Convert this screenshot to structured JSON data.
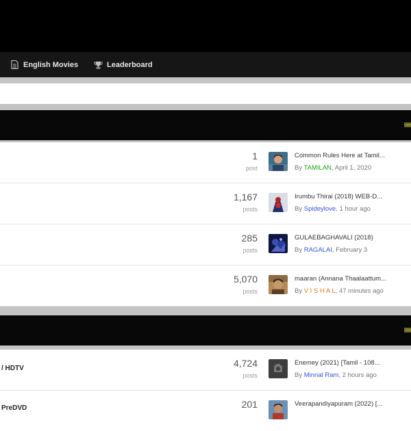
{
  "nav": {
    "items": [
      {
        "label": "English Movies",
        "icon": "document-icon"
      },
      {
        "label": "Leaderboard",
        "icon": "trophy-icon"
      }
    ]
  },
  "sections": [
    {
      "rows": [
        {
          "title": "",
          "count": "1",
          "unit": "post",
          "last_title": "Common Rules Here at Tamil...",
          "by": "By",
          "author": "TAMILAN",
          "author_color": "#1aa51a",
          "time": ", April 1, 2020"
        },
        {
          "title": "",
          "count": "1,167",
          "unit": "posts",
          "last_title": "Irumbu Thirai (2018) WEB-D...",
          "by": "By",
          "author": "Spideylove",
          "author_color": "#3a55d8",
          "time": ", 1 hour ago"
        },
        {
          "title": "",
          "count": "285",
          "unit": "posts",
          "last_title": "GULAEBAGHAVALI (2018)",
          "by": "By",
          "author": "RAGALAI",
          "author_color": "#3a55d8",
          "time": ", February 3"
        },
        {
          "title": "",
          "count": "5,070",
          "unit": "posts",
          "last_title": "maaran (Annana Thaalaattum...",
          "by": "By",
          "author": "V I S H A L",
          "author_color": "#e2761c",
          "time": ", 47 minutes ago"
        }
      ]
    },
    {
      "rows": [
        {
          "title": "/ HDTV",
          "count": "4,724",
          "unit": "posts",
          "last_title": "Enemey (2021) [Tamil - 108...",
          "by": "By",
          "author": "Minnal Ram",
          "author_color": "#3a55d8",
          "time": ", 2 hours ago"
        },
        {
          "title": "PreDVD",
          "count": "201",
          "unit": "",
          "last_title": "Veerapandiyapuram (2022) [...",
          "by": "",
          "author": "",
          "author_color": "#3a55d8",
          "time": ""
        }
      ]
    }
  ]
}
